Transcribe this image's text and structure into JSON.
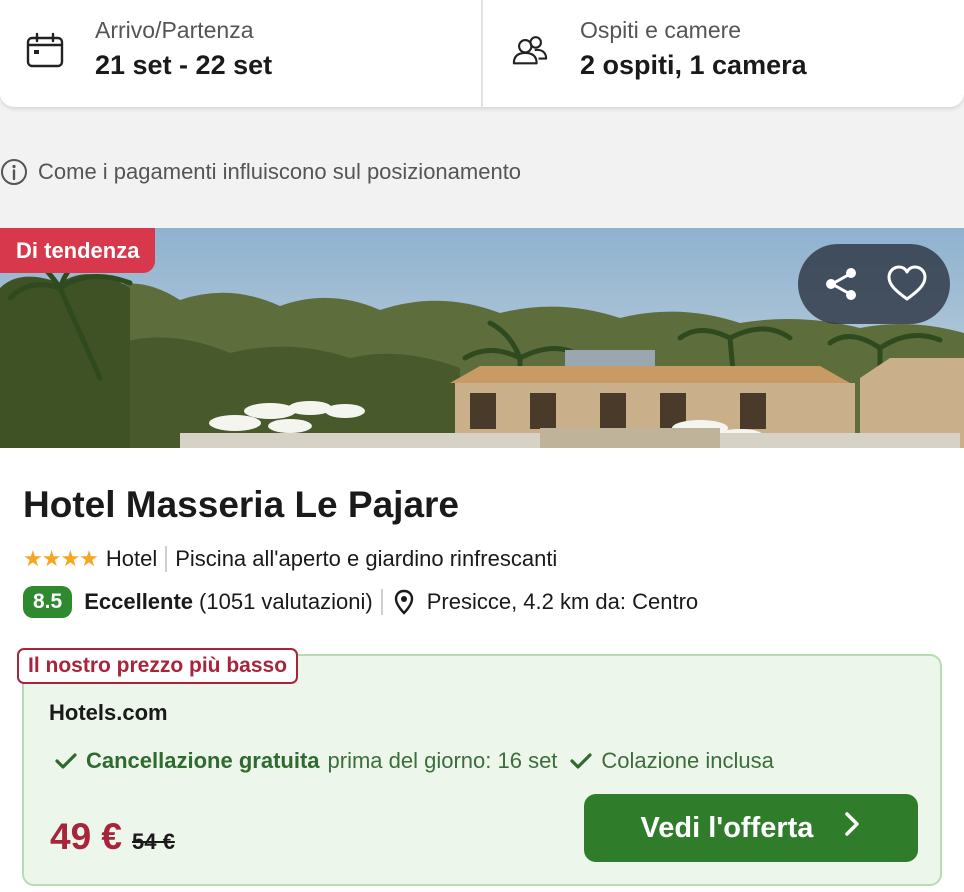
{
  "search": {
    "dates_label": "Arrivo/Partenza",
    "dates_value": "21 set - 22 set",
    "guests_label": "Ospiti e camere",
    "guests_value": "2 ospiti, 1 camera"
  },
  "info_line": "Come i pagamenti influiscono sul posizionamento",
  "hotel": {
    "badge": "Di tendenza",
    "name": "Hotel Masseria Le Pajare",
    "stars": "★★★★",
    "type": "Hotel",
    "feature": "Piscina all'aperto e giardino rinfrescanti",
    "score": "8.5",
    "rating_word": "Eccellente",
    "reviews": "(1051 valutazioni)",
    "location": "Presicce, 4.2 km da: Centro"
  },
  "offer": {
    "badge": "Il nostro prezzo più basso",
    "provider": "Hotels.com",
    "perk1_strong": "Cancellazione gratuita",
    "perk1_detail": "prima del giorno: 16 set",
    "perk2": "Colazione inclusa",
    "price_now": "49 €",
    "price_old": "54 €",
    "cta_label": "Vedi l'offerta"
  },
  "colors": {
    "badge_red": "#d8384c",
    "price_red": "#a8243a",
    "green": "#2f7d2a",
    "score_green": "#2f8a2f",
    "offer_bg": "#edf6ea",
    "star": "#f5a623"
  },
  "icons": [
    "calendar-icon",
    "guests-icon",
    "info-icon",
    "share-icon",
    "heart-icon",
    "map-pin-icon",
    "check-icon",
    "chevron-right-icon"
  ]
}
